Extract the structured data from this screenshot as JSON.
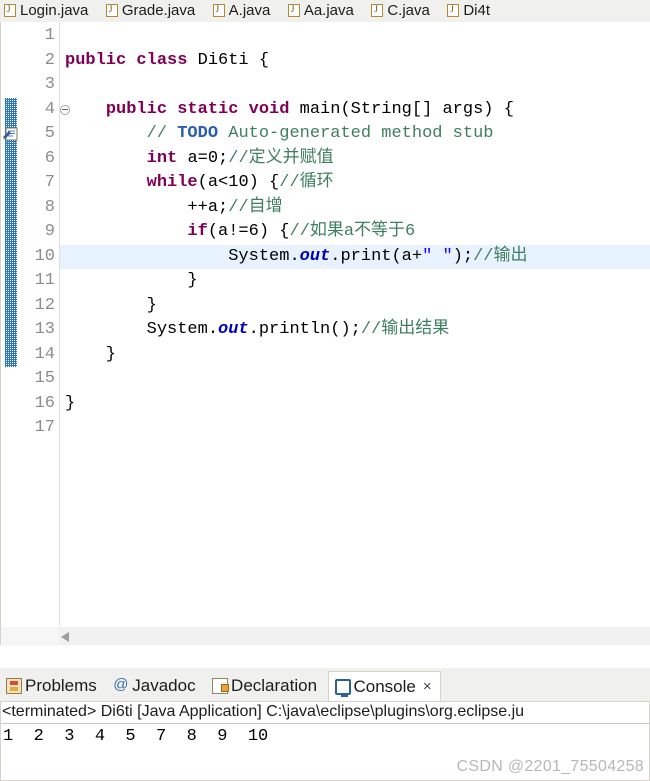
{
  "editor_tabs": [
    {
      "label": "Login.java",
      "icon": "java-file-icon",
      "active": false
    },
    {
      "label": "Grade.java",
      "icon": "java-file-icon",
      "active": false
    },
    {
      "label": "A.java",
      "icon": "java-file-icon",
      "active": false
    },
    {
      "label": "Aa.java",
      "icon": "java-file-icon",
      "active": false
    },
    {
      "label": "C.java",
      "icon": "java-file-icon",
      "active": false
    },
    {
      "label": "Di4t",
      "icon": "java-file-icon",
      "active": false
    }
  ],
  "gutter": {
    "line_numbers": [
      "1",
      "2",
      "3",
      "4",
      "5",
      "6",
      "7",
      "8",
      "9",
      "10",
      "11",
      "12",
      "13",
      "14",
      "15",
      "16",
      "17"
    ],
    "fold_line": "4",
    "todo_marker_line": "5",
    "change_bar_from": "4",
    "change_bar_to": "14"
  },
  "code": {
    "current_line": "10",
    "lines": [
      {
        "n": "1",
        "tokens": []
      },
      {
        "n": "2",
        "tokens": [
          {
            "t": "public class ",
            "c": "k"
          },
          {
            "t": "Di6ti {",
            "c": "pl"
          }
        ]
      },
      {
        "n": "3",
        "tokens": []
      },
      {
        "n": "4",
        "tokens": [
          {
            "t": "    ",
            "c": "pl"
          },
          {
            "t": "public static void ",
            "c": "k"
          },
          {
            "t": "main(String[] args) {",
            "c": "pl"
          }
        ]
      },
      {
        "n": "5",
        "tokens": [
          {
            "t": "        ",
            "c": "pl"
          },
          {
            "t": "// ",
            "c": "cm"
          },
          {
            "t": "TODO",
            "c": "todo"
          },
          {
            "t": " Auto-generated method stub",
            "c": "cm"
          }
        ]
      },
      {
        "n": "6",
        "tokens": [
          {
            "t": "        ",
            "c": "pl"
          },
          {
            "t": "int ",
            "c": "k"
          },
          {
            "t": "a=0;",
            "c": "pl"
          },
          {
            "t": "//定义并赋值",
            "c": "cm"
          }
        ]
      },
      {
        "n": "7",
        "tokens": [
          {
            "t": "        ",
            "c": "pl"
          },
          {
            "t": "while",
            "c": "k"
          },
          {
            "t": "(a<10) {",
            "c": "pl"
          },
          {
            "t": "//循环",
            "c": "cm"
          }
        ]
      },
      {
        "n": "8",
        "tokens": [
          {
            "t": "            ",
            "c": "pl"
          },
          {
            "t": "++a;",
            "c": "pl"
          },
          {
            "t": "//自增",
            "c": "cm"
          }
        ]
      },
      {
        "n": "9",
        "tokens": [
          {
            "t": "            ",
            "c": "pl"
          },
          {
            "t": "if",
            "c": "k"
          },
          {
            "t": "(a!=6) {",
            "c": "pl"
          },
          {
            "t": "//如果a不等于6",
            "c": "cm"
          }
        ]
      },
      {
        "n": "10",
        "tokens": [
          {
            "t": "                ",
            "c": "pl"
          },
          {
            "t": "System.",
            "c": "pl"
          },
          {
            "t": "out",
            "c": "fld"
          },
          {
            "t": ".print(a+",
            "c": "pl"
          },
          {
            "t": "\" \"",
            "c": "str"
          },
          {
            "t": ");",
            "c": "pl"
          },
          {
            "t": "//输出",
            "c": "cm"
          }
        ]
      },
      {
        "n": "11",
        "tokens": [
          {
            "t": "            }",
            "c": "pl"
          }
        ]
      },
      {
        "n": "12",
        "tokens": [
          {
            "t": "        }",
            "c": "pl"
          }
        ]
      },
      {
        "n": "13",
        "tokens": [
          {
            "t": "        System.",
            "c": "pl"
          },
          {
            "t": "out",
            "c": "fld"
          },
          {
            "t": ".println();",
            "c": "pl"
          },
          {
            "t": "//输出结果",
            "c": "cm"
          }
        ]
      },
      {
        "n": "14",
        "tokens": [
          {
            "t": "    }",
            "c": "pl"
          }
        ]
      },
      {
        "n": "15",
        "tokens": []
      },
      {
        "n": "16",
        "tokens": [
          {
            "t": "}",
            "c": "pl"
          }
        ]
      },
      {
        "n": "17",
        "tokens": []
      }
    ]
  },
  "view_tabs": [
    {
      "label": "Problems",
      "icon": "problems-icon",
      "active": false,
      "closeable": false
    },
    {
      "label": "Javadoc",
      "icon": "javadoc-icon",
      "active": false,
      "closeable": false
    },
    {
      "label": "Declaration",
      "icon": "declaration-icon",
      "active": false,
      "closeable": false
    },
    {
      "label": "Console",
      "icon": "console-icon",
      "active": true,
      "closeable": true,
      "close_glyph": "×"
    }
  ],
  "console": {
    "header": "<terminated> Di6ti [Java Application] C:\\java\\eclipse\\plugins\\org.eclipse.ju",
    "output": "1  2  3  4  5  7  8  9  10"
  },
  "watermark": "CSDN @2201_75504258",
  "colors": {
    "keyword": "#7f0055",
    "comment": "#3f7f5f",
    "todo": "#2a5db0",
    "static_field": "#0000c0",
    "string": "#2a00ff",
    "current_line_bg": "#e8f2fe",
    "change_bar": "#1f6fb5",
    "tabbar_bg": "#f0f0ef"
  }
}
